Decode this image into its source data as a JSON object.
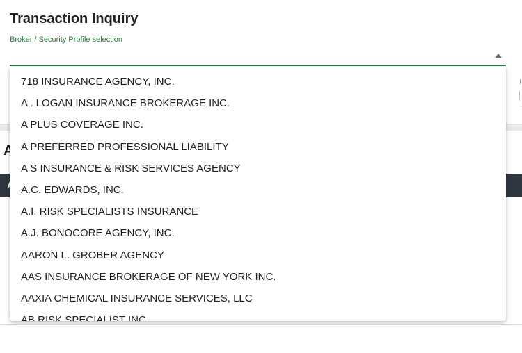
{
  "page": {
    "title": "Transaction Inquiry",
    "section_title_partial": "A",
    "table_header_partial": "A"
  },
  "broker_select": {
    "label": "Broker / Security Profile selection",
    "value": "",
    "state": "open",
    "accent_color": "#2e7a43",
    "caret_icon": "caret-up-icon",
    "options": [
      "718 INSURANCE AGENCY, INC.",
      "A . LOGAN INSURANCE BROKERAGE INC.",
      "A PLUS COVERAGE INC.",
      "A PREFERRED PROFESSIONAL LIABILITY",
      "A S INSURANCE & RISK SERVICES AGENCY",
      "A.C. EDWARDS, INC.",
      "A.I. RISK SPECIALISTS INSURANCE",
      "A.J. BONOCORE AGENCY, INC.",
      "AARON L. GROBER AGENCY",
      "AAS INSURANCE BROKERAGE OF NEW YORK INC.",
      "AAXIA CHEMICAL INSURANCE SERVICES, LLC",
      "AB RISK SPECIALIST INC."
    ]
  },
  "side_field": {
    "label_partial": "I"
  },
  "colors": {
    "header_bar": "#2f3640",
    "separator": "#e9e9e9"
  }
}
